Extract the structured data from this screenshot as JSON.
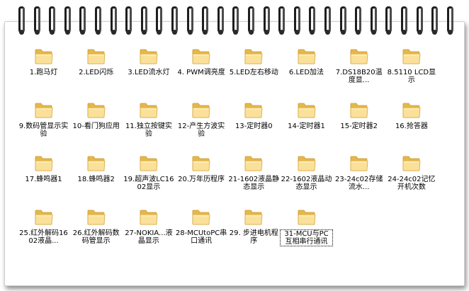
{
  "items": [
    {
      "label": "1.跑马灯"
    },
    {
      "label": "2.LED闪烁"
    },
    {
      "label": "3.LED流水灯"
    },
    {
      "label": "4. PWM调亮度"
    },
    {
      "label": "5.LED左右移动"
    },
    {
      "label": "6.LED加法"
    },
    {
      "label": "7.DS18B20温度显..."
    },
    {
      "label": "8.5110 LCD显示"
    },
    {
      "label": "9.数码管显示实验"
    },
    {
      "label": "10-看门狗应用"
    },
    {
      "label": "11.独立按键实验"
    },
    {
      "label": "12-产生方波实验"
    },
    {
      "label": "13-定时器0"
    },
    {
      "label": "14-定时器1"
    },
    {
      "label": "15-定时器2"
    },
    {
      "label": "16.抢答器"
    },
    {
      "label": "17.蜂鸣器1"
    },
    {
      "label": "18.蜂鸣器2"
    },
    {
      "label": "19.超声波LC1602显示"
    },
    {
      "label": "20.万年历程序"
    },
    {
      "label": "21-1602液晶静态显示"
    },
    {
      "label": "22-1602液晶动态显示"
    },
    {
      "label": "23-24c02存储流水..."
    },
    {
      "label": "24-24c02记忆开机次数"
    },
    {
      "label": "25.红外解码1602液晶..."
    },
    {
      "label": "26.红外解码数码管显示"
    },
    {
      "label": "27-NOKIA...液晶显示"
    },
    {
      "label": "28-MCUtoPC串口通讯"
    },
    {
      "label": "29. 步进电机程序"
    },
    {
      "label": "31-MCU与PC互相串行通讯"
    }
  ],
  "folder_icon": "folder-icon",
  "colors": {
    "folder_light": "#fbe29a",
    "folder_dark": "#e3b540",
    "ring": "#1e1e1e"
  }
}
